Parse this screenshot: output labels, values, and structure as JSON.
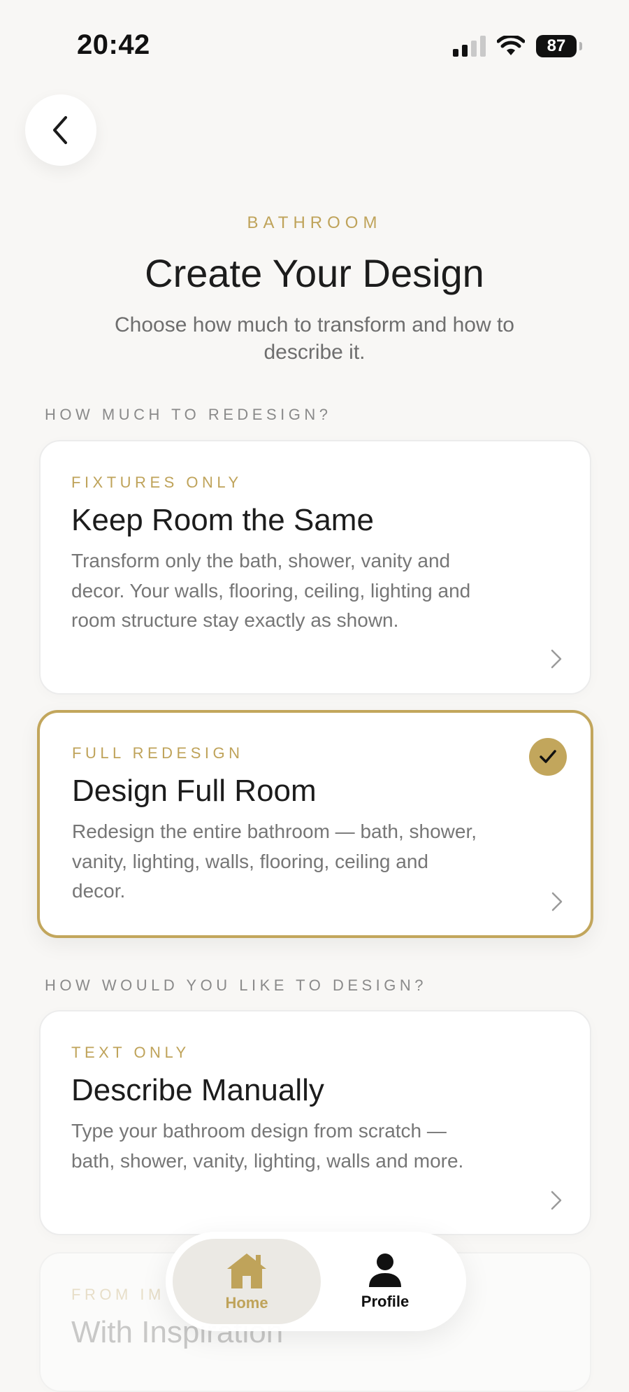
{
  "status_bar": {
    "time": "20:42",
    "battery": "87",
    "icons": [
      "signal-icon",
      "wifi-icon",
      "battery-icon"
    ]
  },
  "header": {
    "back_icon": "chevron-left-icon",
    "eyebrow": "BATHROOM",
    "title": "Create Your Design",
    "subtitle": "Choose how much to transform and how to describe it."
  },
  "sections": {
    "redesign_label": "HOW MUCH TO REDESIGN?",
    "method_label": "HOW WOULD YOU LIKE TO DESIGN?"
  },
  "cards": [
    {
      "eyebrow": "FIXTURES ONLY",
      "title": "Keep Room the Same",
      "description": "Transform only the bath, shower, vanity and decor. Your walls, flooring, ceiling, lighting and room structure stay exactly as shown.",
      "selected": false
    },
    {
      "eyebrow": "FULL REDESIGN",
      "title": "Design Full Room",
      "description": "Redesign the entire bathroom — bath, shower, vanity, lighting, walls, flooring, ceiling and decor.",
      "selected": true
    },
    {
      "eyebrow": "TEXT ONLY",
      "title": "Describe Manually",
      "description": "Type your bathroom design from scratch — bath, shower, vanity, lighting, walls and more.",
      "selected": false
    },
    {
      "eyebrow": "FROM IM",
      "title": "With Inspiration",
      "selected": false
    }
  ],
  "tab_bar": {
    "home_label": "Home",
    "profile_label": "Profile",
    "active": "Home"
  },
  "colors": {
    "accent": "#c2a65c",
    "background": "#f8f7f5",
    "card": "#ffffff",
    "text_primary": "#1c1c1c",
    "text_secondary": "#767676"
  }
}
